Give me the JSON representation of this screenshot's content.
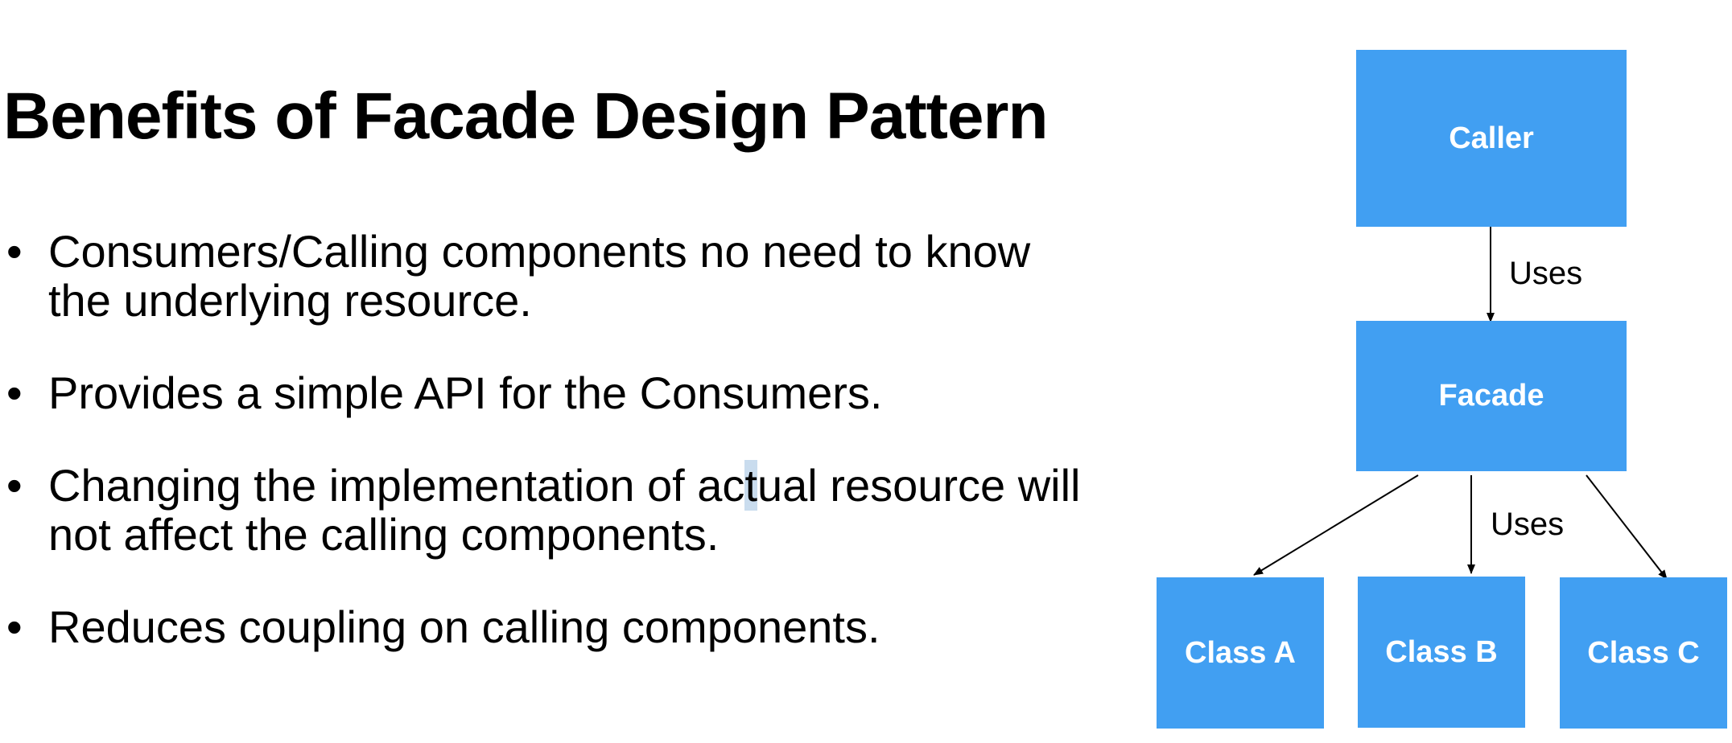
{
  "slide": {
    "title": "Benefits of Facade Design Pattern",
    "bullets": [
      {
        "text": "Consumers/Calling components no need to know the underlying resource."
      },
      {
        "text_before": "Provides a simple API for the Consumers."
      },
      {
        "text_before": "Changing the implementation of ac",
        "highlight": "t",
        "text_after": "ual resource will not affect the calling components."
      },
      {
        "text": "Reduces coupling on calling components."
      }
    ],
    "bullet_glyph": "•"
  },
  "diagram": {
    "nodes": {
      "caller": "Caller",
      "facade": "Facade",
      "class_a": "Class A",
      "class_b": "Class B",
      "class_c": "Class C"
    },
    "edge_labels": {
      "caller_to_facade": "Uses",
      "facade_to_classes": "Uses"
    },
    "colors": {
      "node_fill": "#419ff2",
      "node_text": "#ffffff",
      "arrow": "#000000"
    }
  }
}
